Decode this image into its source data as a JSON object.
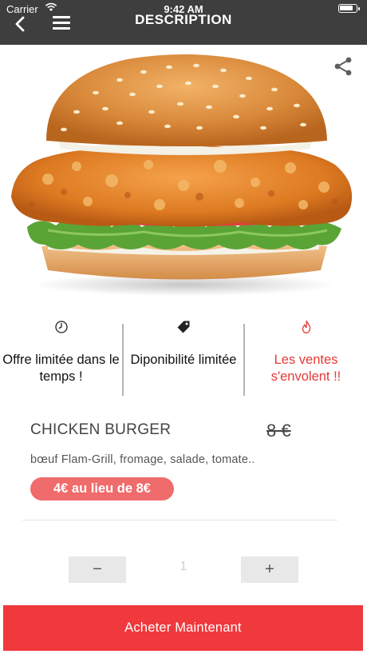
{
  "status_bar": {
    "carrier": "Carrier",
    "time": "9:42 AM"
  },
  "header": {
    "title": "DESCRIPTION",
    "back_icon": "chevron-left-icon",
    "menu_icon": "hamburger-menu-icon"
  },
  "hero": {
    "image": "chicken-burger-photo",
    "share_icon": "share-icon"
  },
  "features": [
    {
      "icon": "clock-icon",
      "text": "Offre limitée dans le temps !"
    },
    {
      "icon": "tag-icon",
      "text": "Diponibilité limitée"
    },
    {
      "icon": "flame-icon",
      "text": "Les ventes s'envolent !!"
    }
  ],
  "product": {
    "name": "CHICKEN BURGER",
    "old_price": "8 €",
    "description": "bœuf Flam-Grill, fromage, salade, tomate..",
    "promo": "4€ au lieu de 8€"
  },
  "quantity": {
    "minus_label": "−",
    "value": "1",
    "plus_label": "+"
  },
  "buy_button": {
    "label": "Acheter Maintenant"
  },
  "colors": {
    "header_bg": "#3e3e3e",
    "accent_red": "#f0393c",
    "promo_bg": "#f06b6b",
    "urgent_text": "#e53935"
  }
}
